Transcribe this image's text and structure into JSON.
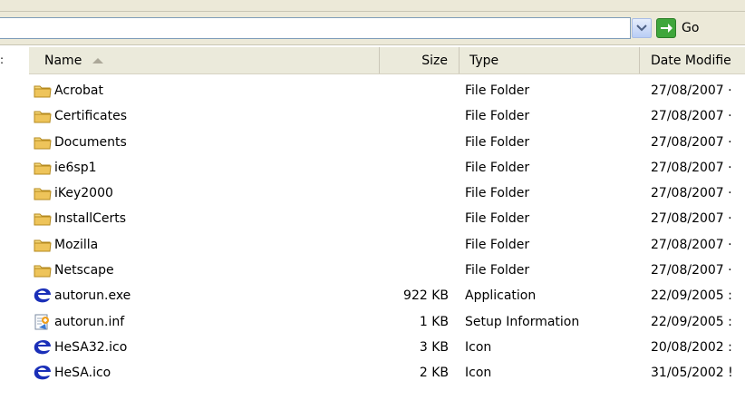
{
  "address": {
    "value": "",
    "go_label": "Go"
  },
  "columns": {
    "name": "Name",
    "size": "Size",
    "type": "Type",
    "date": "Date Modifie"
  },
  "edge_glyph": ":",
  "files": [
    {
      "name": "Acrobat",
      "size": "",
      "type": "File Folder",
      "date": "27/08/2007 ·",
      "icon": "folder-icon"
    },
    {
      "name": "Certificates",
      "size": "",
      "type": "File Folder",
      "date": "27/08/2007 ·",
      "icon": "folder-icon"
    },
    {
      "name": "Documents",
      "size": "",
      "type": "File Folder",
      "date": "27/08/2007 ·",
      "icon": "folder-icon"
    },
    {
      "name": "ie6sp1",
      "size": "",
      "type": "File Folder",
      "date": "27/08/2007 ·",
      "icon": "folder-icon"
    },
    {
      "name": "iKey2000",
      "size": "",
      "type": "File Folder",
      "date": "27/08/2007 ·",
      "icon": "folder-icon"
    },
    {
      "name": "InstallCerts",
      "size": "",
      "type": "File Folder",
      "date": "27/08/2007 ·",
      "icon": "folder-icon"
    },
    {
      "name": "Mozilla",
      "size": "",
      "type": "File Folder",
      "date": "27/08/2007 ·",
      "icon": "folder-icon"
    },
    {
      "name": "Netscape",
      "size": "",
      "type": "File Folder",
      "date": "27/08/2007 ·",
      "icon": "folder-icon"
    },
    {
      "name": "autorun.exe",
      "size": "922 KB",
      "type": "Application",
      "date": "22/09/2005 :",
      "icon": "application-e-icon"
    },
    {
      "name": "autorun.inf",
      "size": "1 KB",
      "type": "Setup Information",
      "date": "22/09/2005 :",
      "icon": "setup-info-icon"
    },
    {
      "name": "HeSA32.ico",
      "size": "3 KB",
      "type": "Icon",
      "date": "20/08/2002 :",
      "icon": "e-logo-icon"
    },
    {
      "name": "HeSA.ico",
      "size": "2 KB",
      "type": "Icon",
      "date": "31/05/2002 !",
      "icon": "e-logo-icon"
    }
  ],
  "colors": {
    "folder": "#e8c45a",
    "e_logo": "#1a2fb8",
    "go_green": "#3fa63b",
    "header_bg": "#ebeadb"
  }
}
